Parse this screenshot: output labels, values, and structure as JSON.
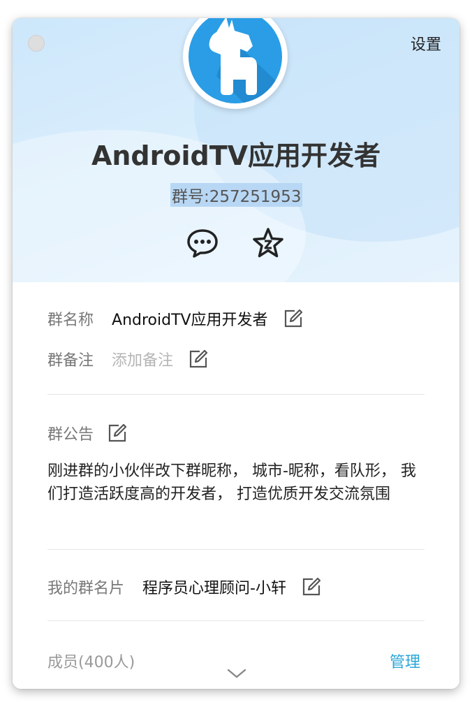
{
  "header": {
    "settings_label": "设置",
    "group_name": "AndroidTV应用开发者",
    "group_id": "群号:257251953",
    "brand_color": "#2a9de6"
  },
  "info": {
    "group_name_label": "群名称",
    "group_name_value": "AndroidTV应用开发者",
    "remark_label": "群备注",
    "remark_placeholder": "添加备注",
    "notice_label": "群公告",
    "notice_text": "刚进群的小伙伴改下群昵称， 城市-昵称，看队形， 我们打造活跃度高的开发者， 打造优质开发交流氛围",
    "my_card_label": "我的群名片",
    "my_card_value": "程序员心理顾问-小轩",
    "members_label": "成员(400人)",
    "manage_label": "管理"
  },
  "icons": {
    "chat": "chat-bubble-icon",
    "favorite": "star-icon",
    "edit": "edit-icon",
    "expand": "chevron-down-icon",
    "avatar": "pony-icon"
  }
}
